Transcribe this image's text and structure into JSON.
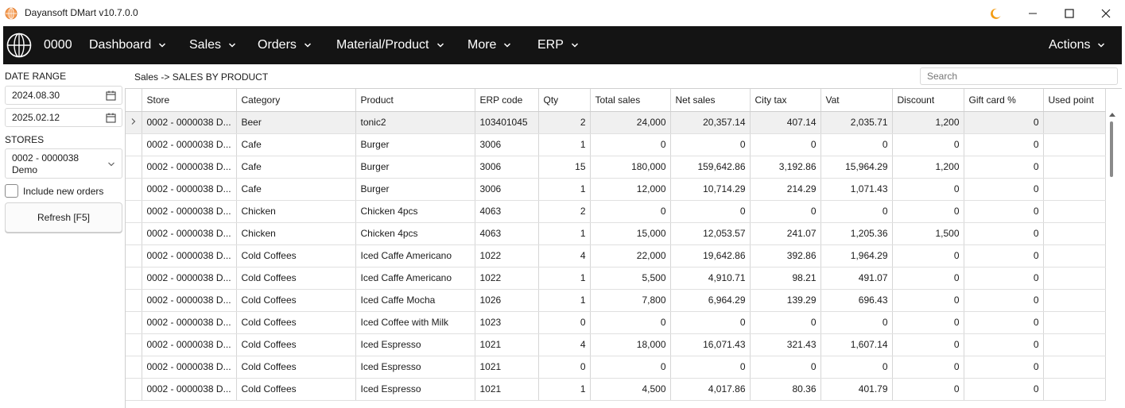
{
  "window": {
    "title": "Dayansoft DMart v10.7.0.0"
  },
  "nav": {
    "code": "0000",
    "items": [
      {
        "label": "Dashboard"
      },
      {
        "label": "Sales"
      },
      {
        "label": "Orders"
      },
      {
        "label": "Material/Product"
      },
      {
        "label": "More"
      },
      {
        "label": "ERP"
      }
    ],
    "actions": "Actions"
  },
  "sidebar": {
    "date_range_label": "DATE RANGE",
    "date_from": "2024.08.30",
    "date_to": "2025.02.12",
    "stores_label": "STORES",
    "store_line1": "0002 - 0000038",
    "store_line2": "Demo",
    "include_new_orders": "Include new orders",
    "refresh": "Refresh [F5]"
  },
  "breadcrumb": "Sales -> SALES BY PRODUCT",
  "search": {
    "placeholder": "Search"
  },
  "table": {
    "columns": [
      "Store",
      "Category",
      "Product",
      "ERP code",
      "Qty",
      "Total sales",
      "Net sales",
      "City tax",
      "Vat",
      "Discount",
      "Gift card %",
      "Used point"
    ],
    "rows": [
      [
        "0002 - 0000038 D...",
        "Beer",
        "tonic2",
        "103401045",
        "2",
        "24,000",
        "20,357.14",
        "407.14",
        "2,035.71",
        "1,200",
        "0",
        ""
      ],
      [
        "0002 - 0000038 D...",
        "Cafe",
        "Burger",
        "3006",
        "1",
        "0",
        "0",
        "0",
        "0",
        "0",
        "0",
        ""
      ],
      [
        "0002 - 0000038 D...",
        "Cafe",
        "Burger",
        "3006",
        "15",
        "180,000",
        "159,642.86",
        "3,192.86",
        "15,964.29",
        "1,200",
        "0",
        ""
      ],
      [
        "0002 - 0000038 D...",
        "Cafe",
        "Burger",
        "3006",
        "1",
        "12,000",
        "10,714.29",
        "214.29",
        "1,071.43",
        "0",
        "0",
        ""
      ],
      [
        "0002 - 0000038 D...",
        "Chicken",
        "Chicken 4pcs",
        "4063",
        "2",
        "0",
        "0",
        "0",
        "0",
        "0",
        "0",
        ""
      ],
      [
        "0002 - 0000038 D...",
        "Chicken",
        "Chicken 4pcs",
        "4063",
        "1",
        "15,000",
        "12,053.57",
        "241.07",
        "1,205.36",
        "1,500",
        "0",
        ""
      ],
      [
        "0002 - 0000038 D...",
        "Cold Coffees",
        "Iced Caffe Americano",
        "1022",
        "4",
        "22,000",
        "19,642.86",
        "392.86",
        "1,964.29",
        "0",
        "0",
        ""
      ],
      [
        "0002 - 0000038 D...",
        "Cold Coffees",
        "Iced Caffe Americano",
        "1022",
        "1",
        "5,500",
        "4,910.71",
        "98.21",
        "491.07",
        "0",
        "0",
        ""
      ],
      [
        "0002 - 0000038 D...",
        "Cold Coffees",
        "Iced Caffe Mocha",
        "1026",
        "1",
        "7,800",
        "6,964.29",
        "139.29",
        "696.43",
        "0",
        "0",
        ""
      ],
      [
        "0002 - 0000038 D...",
        "Cold Coffees",
        "Iced Coffee with Milk",
        "1023",
        "0",
        "0",
        "0",
        "0",
        "0",
        "0",
        "0",
        ""
      ],
      [
        "0002 - 0000038 D...",
        "Cold Coffees",
        "Iced Espresso",
        "1021",
        "4",
        "18,000",
        "16,071.43",
        "321.43",
        "1,607.14",
        "0",
        "0",
        ""
      ],
      [
        "0002 - 0000038 D...",
        "Cold Coffees",
        "Iced Espresso",
        "1021",
        "0",
        "0",
        "0",
        "0",
        "0",
        "0",
        "0",
        ""
      ],
      [
        "0002 - 0000038 D...",
        "Cold Coffees",
        "Iced Espresso",
        "1021",
        "1",
        "4,500",
        "4,017.86",
        "80.36",
        "401.79",
        "0",
        "0",
        ""
      ]
    ]
  },
  "colors": {
    "navbar": "#141414",
    "accent_moon": "#f39c12",
    "app_icon": "#f5a05a"
  }
}
